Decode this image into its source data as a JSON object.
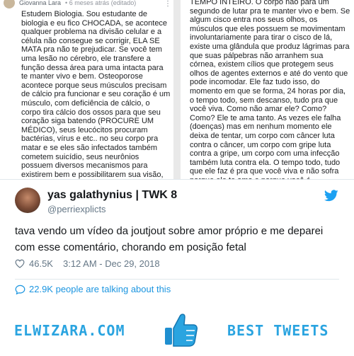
{
  "comment": {
    "author": "Giovanna Lara",
    "time": "• 6 meses atrás (editado)",
    "menu_glyph": "⋮",
    "left_text": "Estudem Biologia. Sou estudante de biologia e eu fico CHOCADA, se acontece qualquer problema na divisão celular e a célula não consegue se corrigir, ELA SE MATA pra não te prejudicar. Se você tem uma lesão no cérebro, ele transfere a função dessa área para uma intacta para te manter vivo e bem. Osteoporose acontece porque seus músculos precisam de cálcio pra funcionar e seu coração é um músculo, com deficiência de cálcio, o corpo tira cálcio dos ossos para que seu coração siga batendo (PROCURE UM MÉDICO), seus leucócitos procuram bactérias, vírus e etc.. no seu corpo pra matar e se eles são infectados também cometem suicídio, seus neurônios possuem diversos mecanismos para existirem bem e possibilitarem sua visão, audição, memória e mais um monte de coisas, tudo isso, o tempo inteiro. O TEMPO INTEIRO. O corpo não para um",
    "right_text": "TEMPO INTEIRO. O corpo não para um segundo de lutar pra te manter vivo e bem. Se algum cisco entra nos seus olhos, os músculos que eles possuem se movimentam involuntariamente para tirar o cisco de lá, existe uma glândula que produz lágrimas para que suas pálpebras não arranhem sua córnea, existem cílios que protegem seus olhos de agentes externos e até do vento que pode incomodar. Ele faz tudo isso, do momento em que se forma, 24 horas por dia, o tempo todo, sem descanso, tudo pra que você viva. Como não amar ele? Como? Como? Ele te ama tanto. As vezes ele falha (doenças) mas em nenhum momento ele deixa de tentar, um corpo com câncer luta contra o câncer, um corpo com gripe luta contra a gripe, um corpo com uma infecção também luta contra ela. O tempo todo, tudo que ele faz é pra que você viva e não sofra porque ele te ama e porque você é importante. A natureza precisa de você."
  },
  "tweet": {
    "display_name": "yas galathynius | TWK 8",
    "handle": "@perriexplicts",
    "text": "tava vendo um vídeo da joutjout sobre amor próprio e me deparei com esse comentário, chorando em posição fetal",
    "likes": "46.5K",
    "timestamp": "3:12 AM - Dec 29, 2018",
    "talking": "22.9K people are talking about this"
  },
  "footer": {
    "brand_left": "ELWIZARA.COM",
    "brand_right": "BEST TWEETS"
  },
  "colors": {
    "twitter_blue": "#1b95e0",
    "brand_blue": "#2aa4e0",
    "text_dark": "#14171a",
    "text_gray": "#657786"
  },
  "icons": [
    "avatar",
    "twitter-bird-icon",
    "heart-icon",
    "comment-bubble-icon",
    "thumbs-up-icon",
    "more-menu-icon"
  ]
}
